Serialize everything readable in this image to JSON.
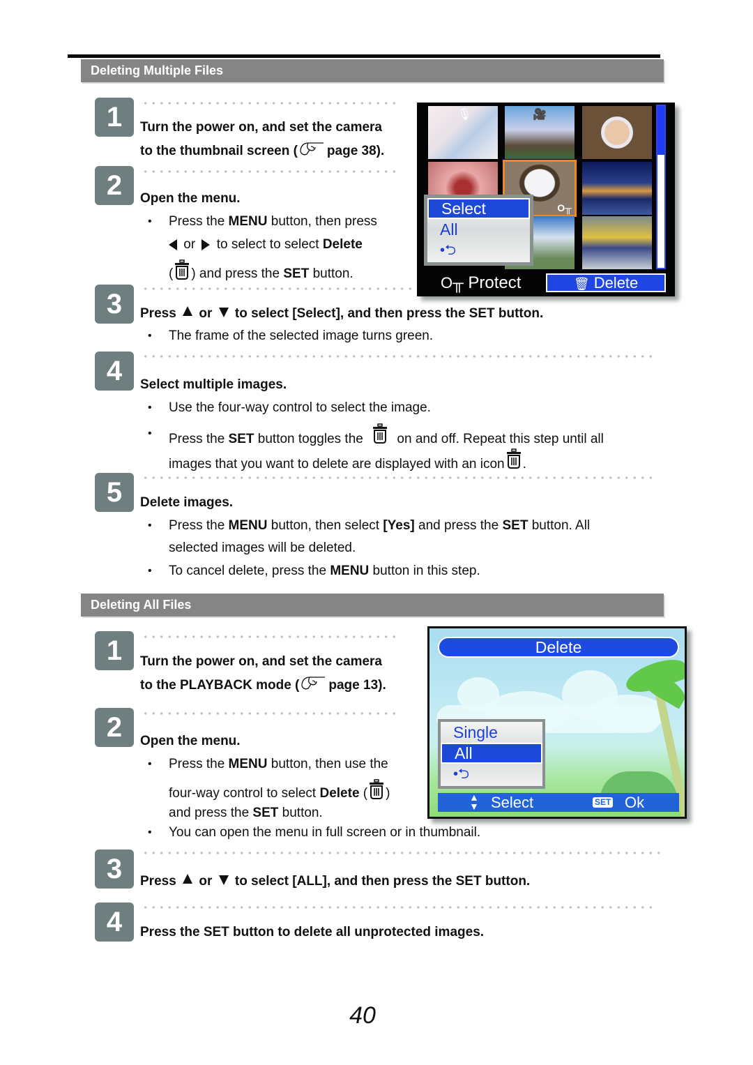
{
  "sections": {
    "multiple": {
      "title": "Deleting Multiple Files",
      "steps": [
        {
          "num": "1",
          "heading_l1": "Turn the power on, and set the camera",
          "heading_l2_pre": "to the thumbnail screen (",
          "heading_l2_post": "page 38)."
        },
        {
          "num": "2",
          "heading": "Open the menu.",
          "b1_l1_pre": "Press the ",
          "b1_l1_bold": "MENU",
          "b1_l1_post": " button, then press",
          "b1_l2_or": "or",
          "b1_l2_mid": "to select to select ",
          "b1_l2_bold": "Delete",
          "b1_l3_open": "(",
          "b1_l3_post": ") and press the ",
          "b1_l3_bold": "SET",
          "b1_l3_end": " button."
        },
        {
          "num": "3",
          "heading_pre": "Press",
          "heading_or": "or",
          "heading_post": "to select [Select], and then press the SET button.",
          "b1": "The frame of the selected image turns green."
        },
        {
          "num": "4",
          "heading": "Select multiple images.",
          "b1": "Use the four-way control to select the image.",
          "b2_pre": "Press the ",
          "b2_bold": "SET",
          "b2_mid": " button toggles the",
          "b2_post": "on and off. Repeat this step until all",
          "b2_l2": "images that you want to delete are displayed with an icon",
          "b2_l2_end": "."
        },
        {
          "num": "5",
          "heading": "Delete images.",
          "b1_pre": "Press the ",
          "b1_bold1": "MENU",
          "b1_mid1": " button, then select ",
          "b1_bold2": "[Yes]",
          "b1_mid2": " and press the ",
          "b1_bold3": "SET",
          "b1_end": " button. All",
          "b1_l2": "selected images will be deleted.",
          "b2_pre": "To cancel delete, press the ",
          "b2_bold": "MENU",
          "b2_post": " button in this step."
        }
      ]
    },
    "all": {
      "title": "Deleting All Files",
      "steps": [
        {
          "num": "1",
          "heading_l1": "Turn the power on, and set the camera",
          "heading_l2_pre": "to the PLAYBACK mode (",
          "heading_l2_post": "page 13)."
        },
        {
          "num": "2",
          "heading": "Open the menu.",
          "b1_l1_pre": "Press the ",
          "b1_l1_bold": "MENU",
          "b1_l1_post": " button, then use the",
          "b1_l2_pre": "four-way control to select ",
          "b1_l2_bold": "Delete",
          "b1_l2_open": " (",
          "b1_l2_close": ")",
          "b1_l3_pre": "and press the ",
          "b1_l3_bold": "SET",
          "b1_l3_post": " button.",
          "b2": "You can open the menu in full screen or in thumbnail."
        },
        {
          "num": "3",
          "heading_pre": "Press",
          "heading_or": "or",
          "heading_post": "to select [ALL], and then press the SET button."
        },
        {
          "num": "4",
          "heading": "Press the SET button to delete all unprotected images."
        }
      ]
    }
  },
  "bullet": "•",
  "camera_screen_thumbnail": {
    "menu_items": [
      "Select",
      "All",
      "•⮌"
    ],
    "active_item": "Select",
    "protect_label": "Protect",
    "delete_label": "Delete",
    "scroll_position_fraction": 0.3,
    "colors": {
      "highlight": "#1c49d8",
      "selected_frame": "#ee8a1c",
      "screen_bg": "#050505"
    }
  },
  "camera_screen_delete": {
    "title": "Delete",
    "menu_items": [
      "Single",
      "All",
      "•⮌"
    ],
    "active_item": "All",
    "updown_glyph": "▲▼",
    "select_label": "Select",
    "set_chip": "SET",
    "ok_label": "Ok",
    "colors": {
      "title_bg": "#1d4ae0",
      "bar_bg": "#2363d8"
    }
  },
  "page_number": "40"
}
